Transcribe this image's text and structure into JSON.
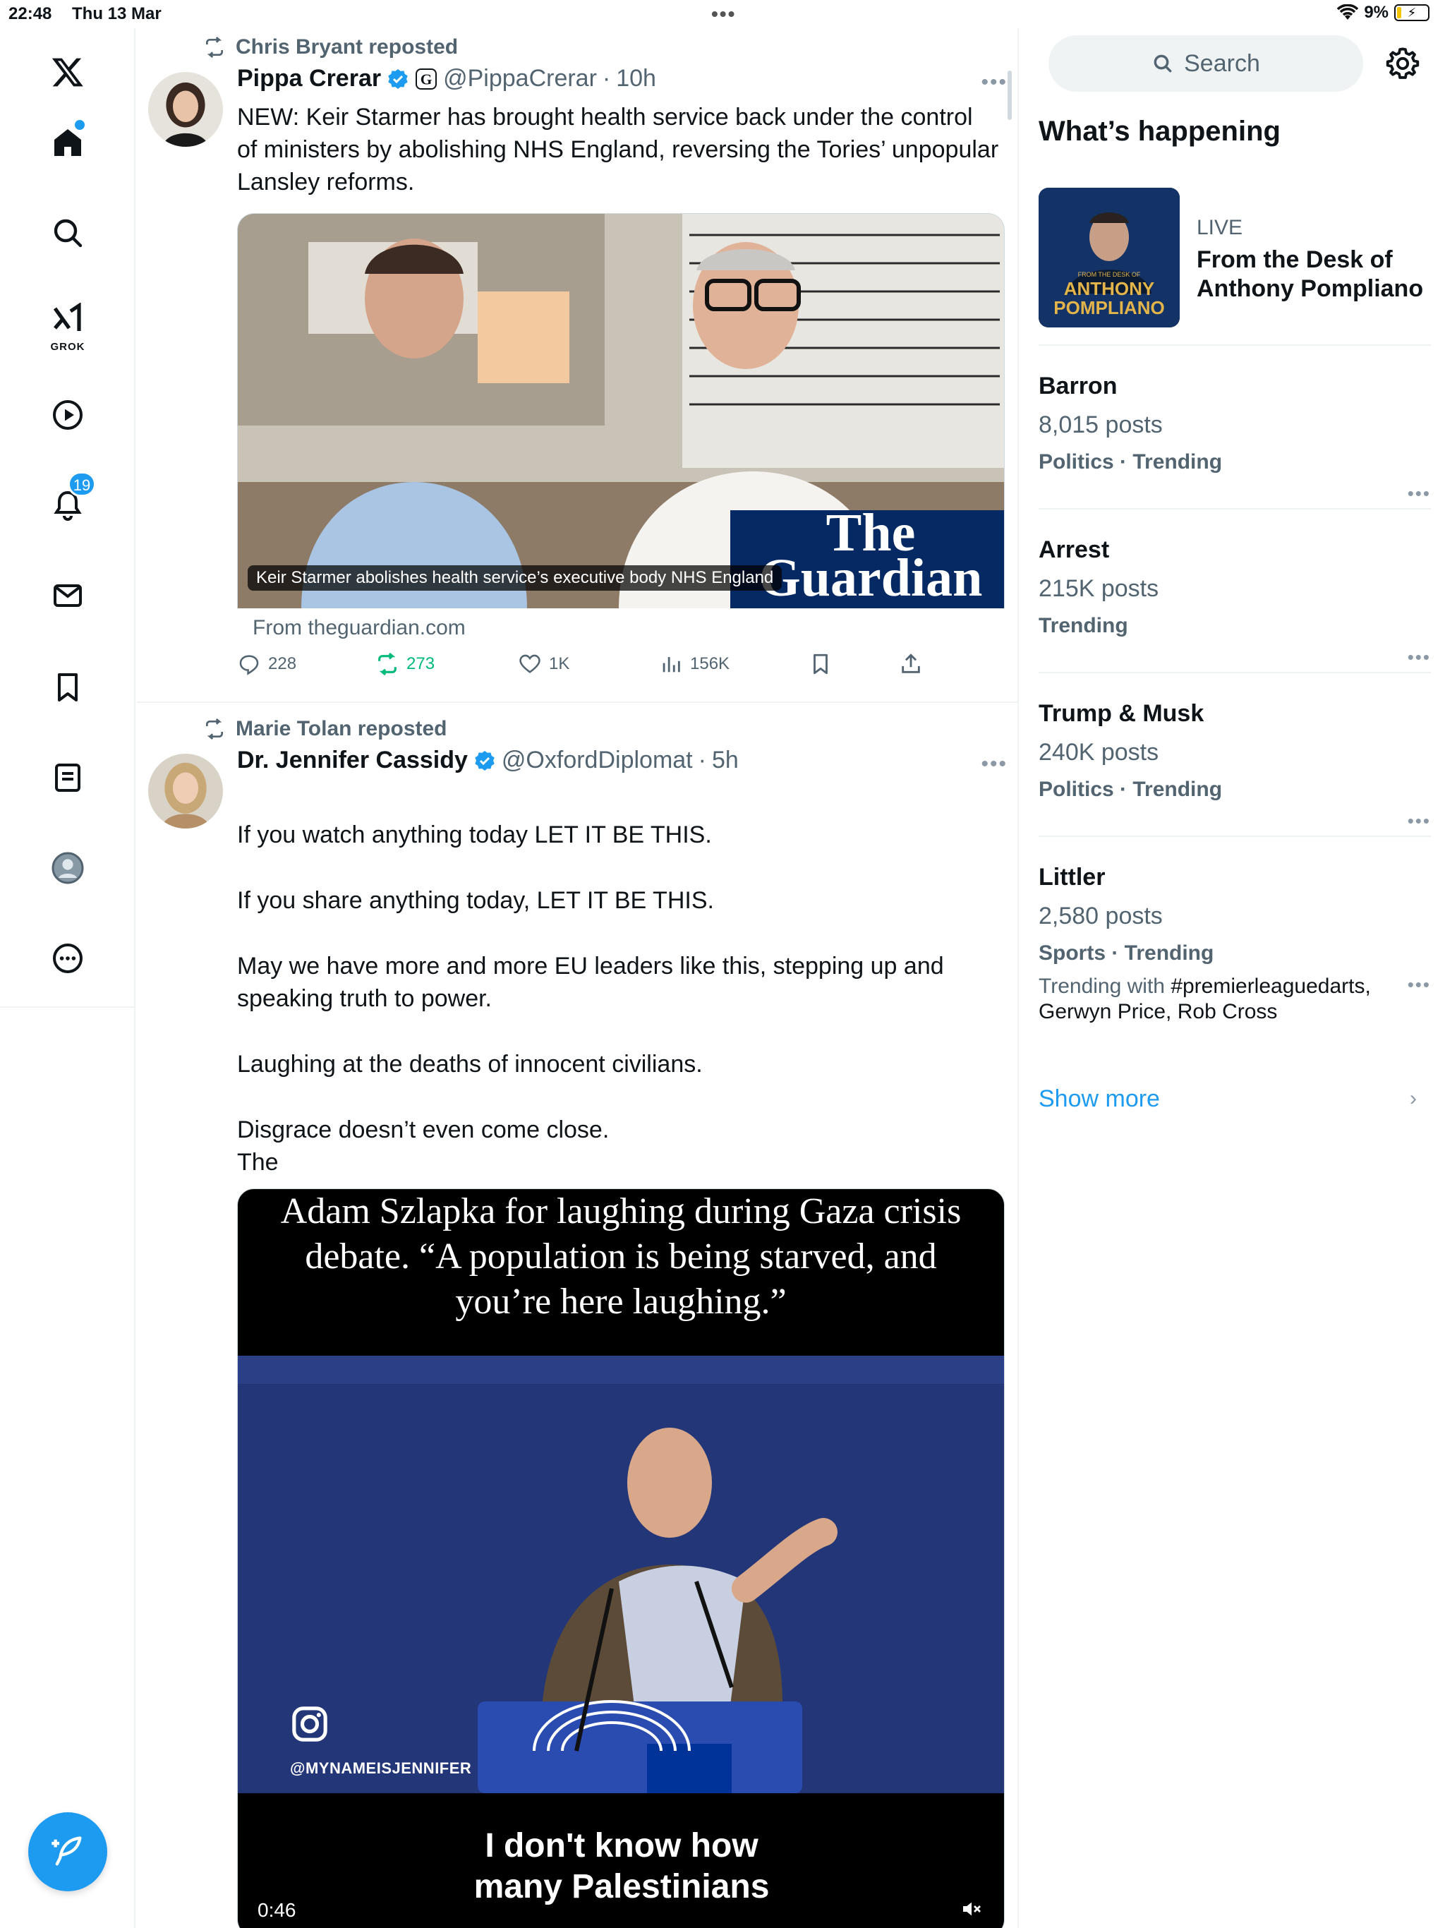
{
  "status_bar": {
    "time": "22:48",
    "date": "Thu 13 Mar",
    "battery": "9%"
  },
  "nav": {
    "notifications_count": "19",
    "grok_label": "GROK"
  },
  "tweets": [
    {
      "reposted_by": "Chris Bryant reposted",
      "name": "Pippa Crerar",
      "handle": "@PippaCrerar",
      "time": "10h",
      "text": "NEW: Keir Starmer has brought health service back under the control of ministers by abolishing NHS England, reversing the Tories’ unpopular Lansley reforms.",
      "card_caption": "Keir Starmer abolishes health service’s executive body NHS England",
      "card_brand_1": "The",
      "card_brand_2": "Guardian",
      "card_source": "From theguardian.com",
      "replies": "228",
      "reposts": "273",
      "likes": "1K",
      "views": "156K"
    },
    {
      "reposted_by": "Marie Tolan reposted",
      "name": "Dr. Jennifer Cassidy",
      "handle": "@OxfordDiplomat",
      "time": "5h",
      "text_lines": [
        "If you watch anything today LET IT BE THIS.",
        "If you share anything today, LET IT BE THIS.",
        "May we have more and more EU leaders like this, stepping up and speaking truth to power.",
        "Laughing at the deaths of innocent civilians.",
        "Disgrace doesn’t even come close.",
        "The"
      ],
      "video_top_caption": "Adam Szlapka for laughing during Gaza crisis debate. “A population is being starved, and you’re here laughing.”",
      "video_watermark": "@MYNAMEISJENNIFER",
      "video_subtitle": "I don't know how many Palestinians",
      "video_duration": "0:46"
    }
  ],
  "sidebar": {
    "search_label": "Search",
    "whats_happening": "What’s happening",
    "live": {
      "label": "LIVE",
      "title": "From the Desk of Anthony Pompliano",
      "thumb_small": "FROM THE DESK OF",
      "thumb_name_1": "ANTHONY",
      "thumb_name_2": "POMPLIANO"
    },
    "trends": [
      {
        "name": "Barron",
        "posts": "8,015 posts",
        "category": "Politics · Trending"
      },
      {
        "name": "Arrest",
        "posts": "215K posts",
        "category": "Trending"
      },
      {
        "name": "Trump & Musk",
        "posts": "240K posts",
        "category": "Politics · Trending"
      },
      {
        "name": "Littler",
        "posts": "2,580 posts",
        "category": "Sports · Trending",
        "with_prefix": "Trending with ",
        "with_list": "#premierleaguedarts, Gerwyn Price, Rob Cross"
      }
    ],
    "show_more": "Show more"
  }
}
